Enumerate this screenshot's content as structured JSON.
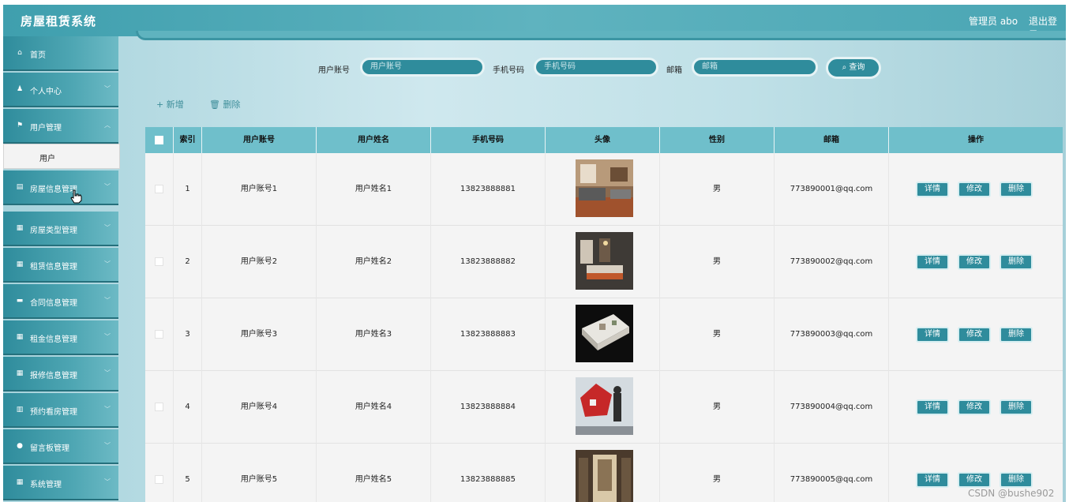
{
  "header": {
    "title": "房屋租赁系统",
    "admin": "管理员 abo",
    "logout": "退出登录"
  },
  "sidebar": {
    "items": [
      {
        "label": "首页",
        "icon": "home-icon",
        "glyph": "⌂"
      },
      {
        "label": "个人中心",
        "icon": "person-icon",
        "glyph": "♟"
      },
      {
        "label": "用户管理",
        "icon": "flag-icon",
        "glyph": "⚑"
      },
      {
        "label": "房屋信息管理",
        "icon": "clipboard-icon",
        "glyph": "▤"
      },
      {
        "label": "房屋类型管理",
        "icon": "grid-icon",
        "glyph": "▦"
      },
      {
        "label": "租赁信息管理",
        "icon": "grid-icon",
        "glyph": "▦"
      },
      {
        "label": "合同信息管理",
        "icon": "card-icon",
        "glyph": "▬"
      },
      {
        "label": "租金信息管理",
        "icon": "grid-icon",
        "glyph": "▦"
      },
      {
        "label": "报修信息管理",
        "icon": "grid-icon",
        "glyph": "▦"
      },
      {
        "label": "预约看房管理",
        "icon": "chart-icon",
        "glyph": "▥"
      },
      {
        "label": "留言板管理",
        "icon": "location-icon",
        "glyph": "●"
      },
      {
        "label": "系统管理",
        "icon": "grid-icon",
        "glyph": "▦"
      }
    ],
    "sub_item": "用户"
  },
  "search": {
    "account_label": "用户账号",
    "account_placeholder": "用户账号",
    "phone_label": "手机号码",
    "phone_placeholder": "手机号码",
    "email_label": "邮箱",
    "email_placeholder": "邮箱",
    "button": "查询"
  },
  "actions": {
    "add": "+ 新增",
    "delete": "🗑 删除"
  },
  "table": {
    "headers": [
      "索引",
      "用户账号",
      "用户姓名",
      "手机号码",
      "头像",
      "性别",
      "邮箱",
      "操作"
    ],
    "rows": [
      {
        "index": "1",
        "account": "用户账号1",
        "name": "用户姓名1",
        "phone": "13823888881",
        "gender": "男",
        "email": "773890001@qq.com"
      },
      {
        "index": "2",
        "account": "用户账号2",
        "name": "用户姓名2",
        "phone": "13823888882",
        "gender": "男",
        "email": "773890002@qq.com"
      },
      {
        "index": "3",
        "account": "用户账号3",
        "name": "用户姓名3",
        "phone": "13823888883",
        "gender": "男",
        "email": "773890003@qq.com"
      },
      {
        "index": "4",
        "account": "用户账号4",
        "name": "用户姓名4",
        "phone": "13823888884",
        "gender": "男",
        "email": "773890004@qq.com"
      },
      {
        "index": "5",
        "account": "用户账号5",
        "name": "用户姓名5",
        "phone": "13823888885",
        "gender": "男",
        "email": "773890005@qq.com"
      }
    ],
    "op_detail": "详情",
    "op_edit": "修改",
    "op_delete": "删除"
  },
  "watermark": "CSDN @bushe902",
  "colors": {
    "accent": "#2f8c9c",
    "header": "#6fbfcb"
  }
}
